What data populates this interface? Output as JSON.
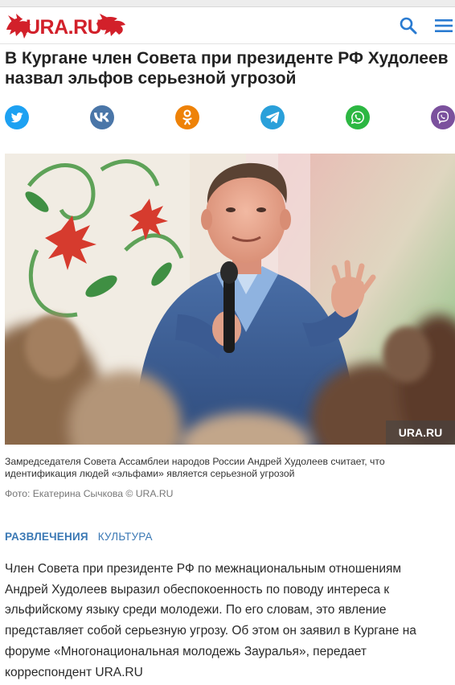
{
  "header": {
    "logo_text": "URA.RU",
    "search_icon": "search-icon",
    "menu_icon": "hamburger-menu-icon"
  },
  "article": {
    "title": "В Кургане член Совета при президенте РФ Худолеев назвал эльфов серьезной угрозой",
    "photo_watermark": "URA.RU",
    "caption": "Замредседателя Совета Ассамблеи народов России Андрей Худолеев считает, что идентификация людей «эльфами» является серьезной угрозой",
    "credit": "Фото: Екатерина Сычкова © URA.RU",
    "tags": [
      "РАЗВЛЕЧЕНИЯ",
      "КУЛЬТУРА"
    ],
    "lead": "Член Совета при президенте РФ по межнациональным отношениям Андрей Худолеев выразил обеспокоенность по поводу интереса к эльфийскому языку среди молодежи. По его словам, это явление представляет собой серьезную угрозу. Об этом он заявил в Кургане на форуме «Многонациональная молодежь Зауралья», передает корреспондент URA.RU"
  },
  "share": [
    {
      "name": "twitter",
      "icon": "twitter-icon",
      "color": "#1da1f2"
    },
    {
      "name": "vk",
      "icon": "vk-icon",
      "color": "#4a76a8"
    },
    {
      "name": "odnoklassniki",
      "icon": "odnoklassniki-icon",
      "color": "#ee8208"
    },
    {
      "name": "telegram",
      "icon": "telegram-icon",
      "color": "#2aa0da"
    },
    {
      "name": "whatsapp",
      "icon": "whatsapp-icon",
      "color": "#2cb742"
    },
    {
      "name": "viber",
      "icon": "viber-icon",
      "color": "#7b519d"
    }
  ],
  "colors": {
    "brand_red": "#d2202a",
    "link_blue": "#3a78b4",
    "header_icon": "#2a7bd1"
  }
}
